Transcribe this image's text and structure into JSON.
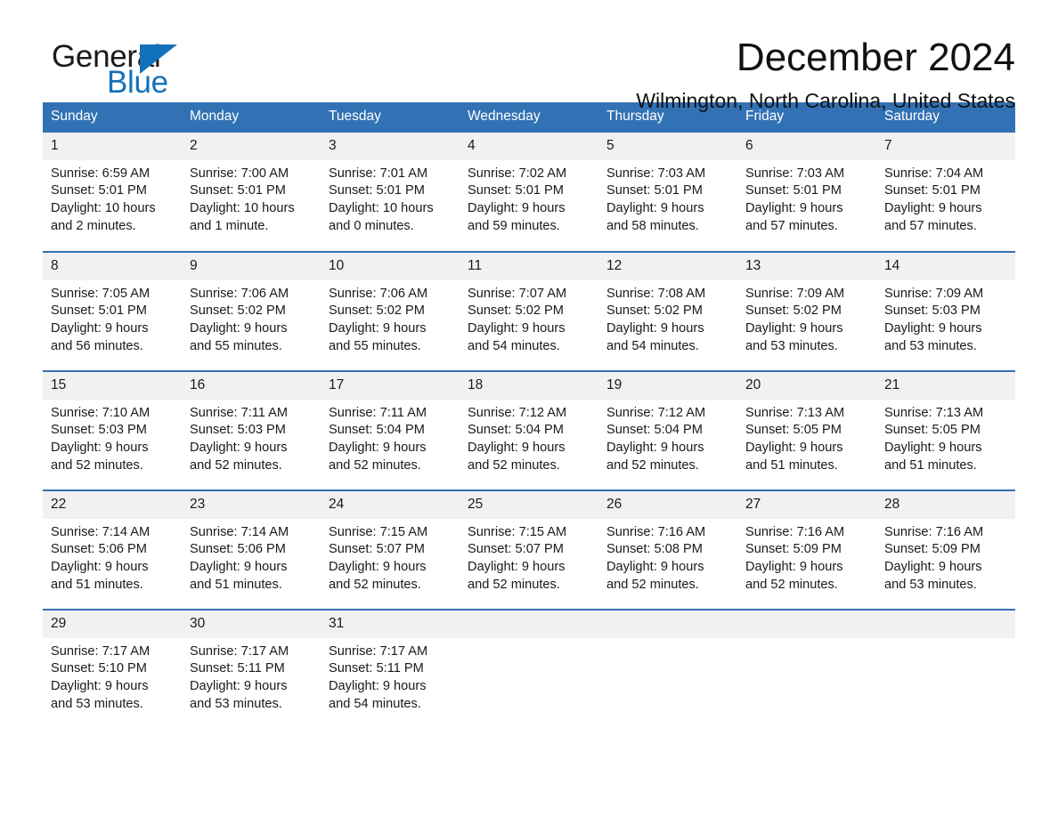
{
  "brand": {
    "name_part1": "General",
    "name_part2": "Blue",
    "accent_color": "#1271bb"
  },
  "header": {
    "month_title": "December 2024",
    "location": "Wilmington, North Carolina, United States"
  },
  "calendar": {
    "header_color": "#3272b4",
    "daynum_band_color": "#f1f1f1",
    "weekday_headers": [
      "Sunday",
      "Monday",
      "Tuesday",
      "Wednesday",
      "Thursday",
      "Friday",
      "Saturday"
    ],
    "weeks": [
      [
        {
          "day": "1",
          "sunrise": "Sunrise: 6:59 AM",
          "sunset": "Sunset: 5:01 PM",
          "daylight_line1": "Daylight: 10 hours",
          "daylight_line2": "and 2 minutes."
        },
        {
          "day": "2",
          "sunrise": "Sunrise: 7:00 AM",
          "sunset": "Sunset: 5:01 PM",
          "daylight_line1": "Daylight: 10 hours",
          "daylight_line2": "and 1 minute."
        },
        {
          "day": "3",
          "sunrise": "Sunrise: 7:01 AM",
          "sunset": "Sunset: 5:01 PM",
          "daylight_line1": "Daylight: 10 hours",
          "daylight_line2": "and 0 minutes."
        },
        {
          "day": "4",
          "sunrise": "Sunrise: 7:02 AM",
          "sunset": "Sunset: 5:01 PM",
          "daylight_line1": "Daylight: 9 hours",
          "daylight_line2": "and 59 minutes."
        },
        {
          "day": "5",
          "sunrise": "Sunrise: 7:03 AM",
          "sunset": "Sunset: 5:01 PM",
          "daylight_line1": "Daylight: 9 hours",
          "daylight_line2": "and 58 minutes."
        },
        {
          "day": "6",
          "sunrise": "Sunrise: 7:03 AM",
          "sunset": "Sunset: 5:01 PM",
          "daylight_line1": "Daylight: 9 hours",
          "daylight_line2": "and 57 minutes."
        },
        {
          "day": "7",
          "sunrise": "Sunrise: 7:04 AM",
          "sunset": "Sunset: 5:01 PM",
          "daylight_line1": "Daylight: 9 hours",
          "daylight_line2": "and 57 minutes."
        }
      ],
      [
        {
          "day": "8",
          "sunrise": "Sunrise: 7:05 AM",
          "sunset": "Sunset: 5:01 PM",
          "daylight_line1": "Daylight: 9 hours",
          "daylight_line2": "and 56 minutes."
        },
        {
          "day": "9",
          "sunrise": "Sunrise: 7:06 AM",
          "sunset": "Sunset: 5:02 PM",
          "daylight_line1": "Daylight: 9 hours",
          "daylight_line2": "and 55 minutes."
        },
        {
          "day": "10",
          "sunrise": "Sunrise: 7:06 AM",
          "sunset": "Sunset: 5:02 PM",
          "daylight_line1": "Daylight: 9 hours",
          "daylight_line2": "and 55 minutes."
        },
        {
          "day": "11",
          "sunrise": "Sunrise: 7:07 AM",
          "sunset": "Sunset: 5:02 PM",
          "daylight_line1": "Daylight: 9 hours",
          "daylight_line2": "and 54 minutes."
        },
        {
          "day": "12",
          "sunrise": "Sunrise: 7:08 AM",
          "sunset": "Sunset: 5:02 PM",
          "daylight_line1": "Daylight: 9 hours",
          "daylight_line2": "and 54 minutes."
        },
        {
          "day": "13",
          "sunrise": "Sunrise: 7:09 AM",
          "sunset": "Sunset: 5:02 PM",
          "daylight_line1": "Daylight: 9 hours",
          "daylight_line2": "and 53 minutes."
        },
        {
          "day": "14",
          "sunrise": "Sunrise: 7:09 AM",
          "sunset": "Sunset: 5:03 PM",
          "daylight_line1": "Daylight: 9 hours",
          "daylight_line2": "and 53 minutes."
        }
      ],
      [
        {
          "day": "15",
          "sunrise": "Sunrise: 7:10 AM",
          "sunset": "Sunset: 5:03 PM",
          "daylight_line1": "Daylight: 9 hours",
          "daylight_line2": "and 52 minutes."
        },
        {
          "day": "16",
          "sunrise": "Sunrise: 7:11 AM",
          "sunset": "Sunset: 5:03 PM",
          "daylight_line1": "Daylight: 9 hours",
          "daylight_line2": "and 52 minutes."
        },
        {
          "day": "17",
          "sunrise": "Sunrise: 7:11 AM",
          "sunset": "Sunset: 5:04 PM",
          "daylight_line1": "Daylight: 9 hours",
          "daylight_line2": "and 52 minutes."
        },
        {
          "day": "18",
          "sunrise": "Sunrise: 7:12 AM",
          "sunset": "Sunset: 5:04 PM",
          "daylight_line1": "Daylight: 9 hours",
          "daylight_line2": "and 52 minutes."
        },
        {
          "day": "19",
          "sunrise": "Sunrise: 7:12 AM",
          "sunset": "Sunset: 5:04 PM",
          "daylight_line1": "Daylight: 9 hours",
          "daylight_line2": "and 52 minutes."
        },
        {
          "day": "20",
          "sunrise": "Sunrise: 7:13 AM",
          "sunset": "Sunset: 5:05 PM",
          "daylight_line1": "Daylight: 9 hours",
          "daylight_line2": "and 51 minutes."
        },
        {
          "day": "21",
          "sunrise": "Sunrise: 7:13 AM",
          "sunset": "Sunset: 5:05 PM",
          "daylight_line1": "Daylight: 9 hours",
          "daylight_line2": "and 51 minutes."
        }
      ],
      [
        {
          "day": "22",
          "sunrise": "Sunrise: 7:14 AM",
          "sunset": "Sunset: 5:06 PM",
          "daylight_line1": "Daylight: 9 hours",
          "daylight_line2": "and 51 minutes."
        },
        {
          "day": "23",
          "sunrise": "Sunrise: 7:14 AM",
          "sunset": "Sunset: 5:06 PM",
          "daylight_line1": "Daylight: 9 hours",
          "daylight_line2": "and 51 minutes."
        },
        {
          "day": "24",
          "sunrise": "Sunrise: 7:15 AM",
          "sunset": "Sunset: 5:07 PM",
          "daylight_line1": "Daylight: 9 hours",
          "daylight_line2": "and 52 minutes."
        },
        {
          "day": "25",
          "sunrise": "Sunrise: 7:15 AM",
          "sunset": "Sunset: 5:07 PM",
          "daylight_line1": "Daylight: 9 hours",
          "daylight_line2": "and 52 minutes."
        },
        {
          "day": "26",
          "sunrise": "Sunrise: 7:16 AM",
          "sunset": "Sunset: 5:08 PM",
          "daylight_line1": "Daylight: 9 hours",
          "daylight_line2": "and 52 minutes."
        },
        {
          "day": "27",
          "sunrise": "Sunrise: 7:16 AM",
          "sunset": "Sunset: 5:09 PM",
          "daylight_line1": "Daylight: 9 hours",
          "daylight_line2": "and 52 minutes."
        },
        {
          "day": "28",
          "sunrise": "Sunrise: 7:16 AM",
          "sunset": "Sunset: 5:09 PM",
          "daylight_line1": "Daylight: 9 hours",
          "daylight_line2": "and 53 minutes."
        }
      ],
      [
        {
          "day": "29",
          "sunrise": "Sunrise: 7:17 AM",
          "sunset": "Sunset: 5:10 PM",
          "daylight_line1": "Daylight: 9 hours",
          "daylight_line2": "and 53 minutes."
        },
        {
          "day": "30",
          "sunrise": "Sunrise: 7:17 AM",
          "sunset": "Sunset: 5:11 PM",
          "daylight_line1": "Daylight: 9 hours",
          "daylight_line2": "and 53 minutes."
        },
        {
          "day": "31",
          "sunrise": "Sunrise: 7:17 AM",
          "sunset": "Sunset: 5:11 PM",
          "daylight_line1": "Daylight: 9 hours",
          "daylight_line2": "and 54 minutes."
        },
        {
          "day": "",
          "sunrise": "",
          "sunset": "",
          "daylight_line1": "",
          "daylight_line2": ""
        },
        {
          "day": "",
          "sunrise": "",
          "sunset": "",
          "daylight_line1": "",
          "daylight_line2": ""
        },
        {
          "day": "",
          "sunrise": "",
          "sunset": "",
          "daylight_line1": "",
          "daylight_line2": ""
        },
        {
          "day": "",
          "sunrise": "",
          "sunset": "",
          "daylight_line1": "",
          "daylight_line2": ""
        }
      ]
    ]
  }
}
